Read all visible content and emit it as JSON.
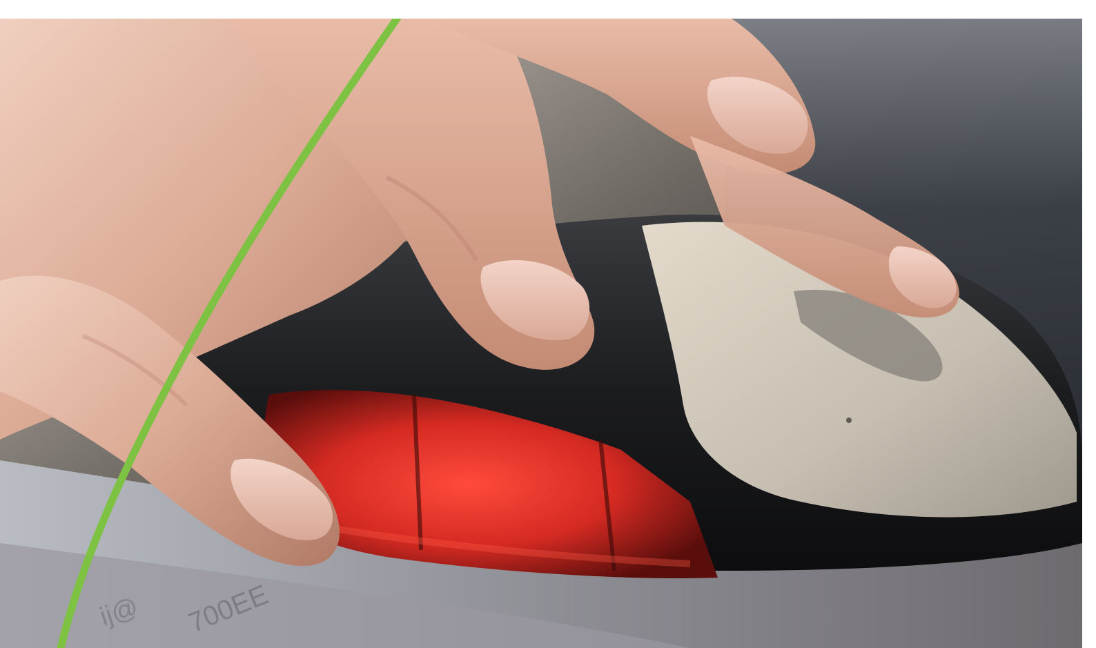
{
  "scene": {
    "subject": "hand-on-computer-mouse",
    "accent_color": "#7dc242",
    "mouse_glow_color": "#e8302a",
    "mouse_body_color": "#1b1c1e",
    "mouse_button_color": "#c9c1b4",
    "skin_color": "#d9a58f",
    "background_color": "#3a3d44"
  }
}
